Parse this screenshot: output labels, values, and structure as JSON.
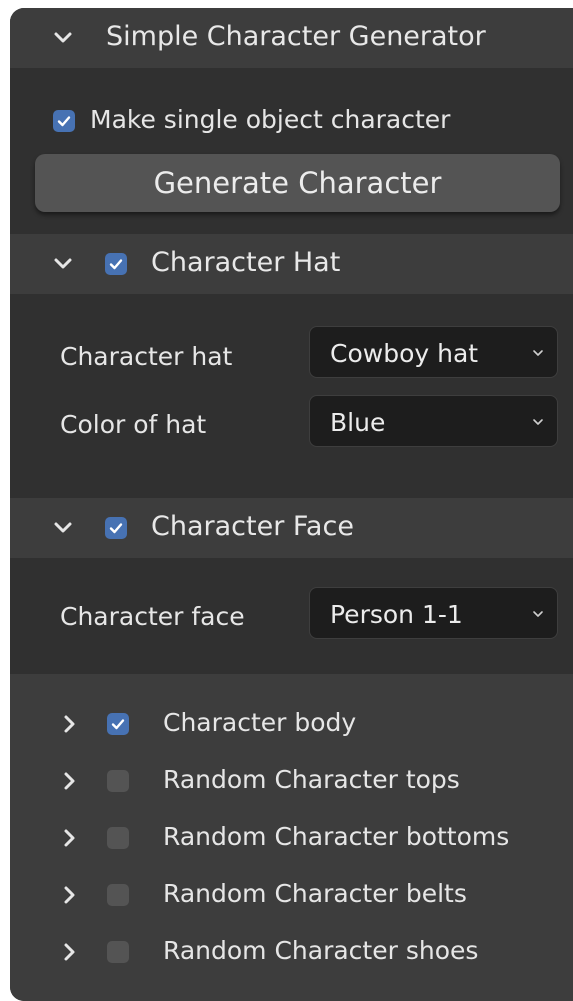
{
  "panel": {
    "title": "Simple Character Generator",
    "single_object_label": "Make single object character",
    "generate_button": "Generate Character"
  },
  "hat": {
    "title": "Character Hat",
    "hat_label": "Character hat",
    "hat_value": "Cowboy hat",
    "color_label": "Color of hat",
    "color_value": "Blue"
  },
  "face": {
    "title": "Character Face",
    "face_label": "Character face",
    "face_value": "Person 1-1"
  },
  "subpanels": [
    {
      "label": "Character body",
      "checked": true
    },
    {
      "label": "Random Character tops",
      "checked": false
    },
    {
      "label": "Random Character bottoms",
      "checked": false
    },
    {
      "label": "Random Character belts",
      "checked": false
    },
    {
      "label": "Random Character shoes",
      "checked": false
    }
  ],
  "colors": {
    "accent": "#4772b3",
    "panel_bg": "#303030",
    "header_bg": "#3d3d3d",
    "field_bg": "#1d1d1d",
    "button_bg": "#545454"
  },
  "icons": {
    "expanded": "chevron-down-icon",
    "collapsed": "chevron-right-icon",
    "dropdown": "chevron-down-icon",
    "checked": "checkmark-icon"
  }
}
